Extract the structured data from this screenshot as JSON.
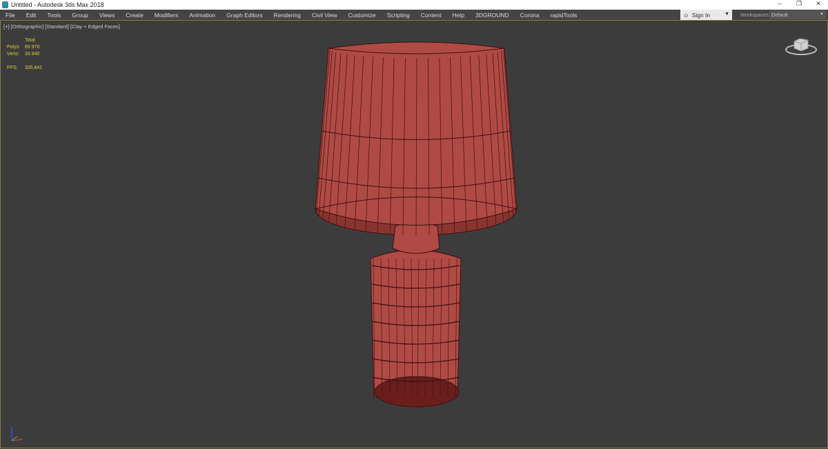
{
  "title": "Untitled - Autodesk 3ds Max 2018",
  "window_controls": {
    "minimize": "–",
    "restore": "❐",
    "close": "✕"
  },
  "menu": [
    "File",
    "Edit",
    "Tools",
    "Group",
    "Views",
    "Create",
    "Modifiers",
    "Animation",
    "Graph Editors",
    "Rendering",
    "Civil View",
    "Customize",
    "Scripting",
    "Content",
    "Help",
    "3DGROUND",
    "Corona",
    "rapidTools"
  ],
  "signin": {
    "label": "Sign In",
    "icon": "user-icon"
  },
  "workspaces": {
    "label": "Workspaces:",
    "value": "Default"
  },
  "viewport": {
    "label": "[+] [Orthographic] [Standard] [Clay + Edged Faces]",
    "stats": {
      "header": "Total",
      "polys_label": "Polys:",
      "polys": "65 970",
      "verts_label": "Verts:",
      "verts": "33 840",
      "fps_label": "FPS:",
      "fps": "335,841"
    }
  },
  "colors": {
    "model": "#b04a44",
    "wire": "#3a1010",
    "viewport_bg": "#3c3c3c"
  }
}
